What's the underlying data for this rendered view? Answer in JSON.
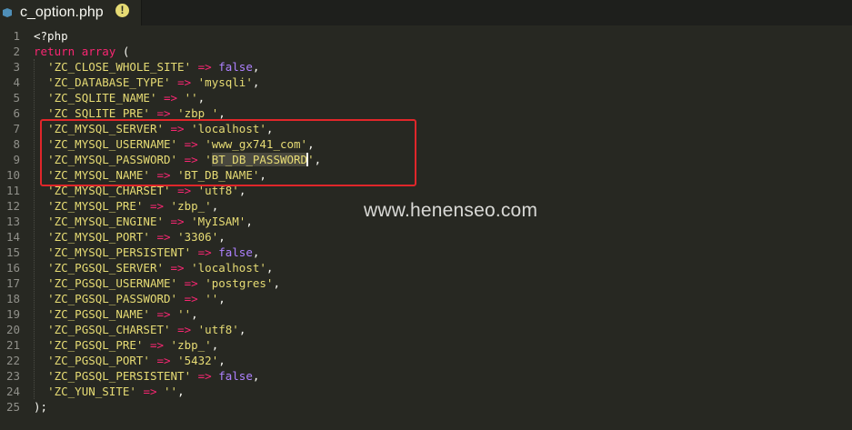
{
  "tab": {
    "filename": "c_option.php",
    "warning_glyph": "!"
  },
  "watermark": "www.henenseo.com",
  "colors": {
    "background": "#272822",
    "string": "#e6db74",
    "operator": "#f92672",
    "constant": "#ae81ff",
    "highlight_box": "#e0262a"
  },
  "lines": [
    {
      "n": "1",
      "segs": [
        [
          "p",
          "<?php"
        ]
      ]
    },
    {
      "n": "2",
      "segs": [
        [
          "k",
          "return"
        ],
        [
          "p",
          " "
        ],
        [
          "k",
          "array"
        ],
        [
          "p",
          " ("
        ]
      ]
    },
    {
      "n": "3",
      "segs": [
        [
          "i",
          "  "
        ],
        [
          "s",
          "'ZC_CLOSE_WHOLE_SITE'"
        ],
        [
          "p",
          " "
        ],
        [
          "o",
          "=>"
        ],
        [
          "p",
          " "
        ],
        [
          "c",
          "false"
        ],
        [
          "p",
          ","
        ]
      ]
    },
    {
      "n": "4",
      "segs": [
        [
          "i",
          "  "
        ],
        [
          "s",
          "'ZC_DATABASE_TYPE'"
        ],
        [
          "p",
          " "
        ],
        [
          "o",
          "=>"
        ],
        [
          "p",
          " "
        ],
        [
          "s",
          "'mysqli'"
        ],
        [
          "p",
          ","
        ]
      ]
    },
    {
      "n": "5",
      "segs": [
        [
          "i",
          "  "
        ],
        [
          "s",
          "'ZC_SQLITE_NAME'"
        ],
        [
          "p",
          " "
        ],
        [
          "o",
          "=>"
        ],
        [
          "p",
          " "
        ],
        [
          "s",
          "''"
        ],
        [
          "p",
          ","
        ]
      ]
    },
    {
      "n": "6",
      "segs": [
        [
          "i",
          "  "
        ],
        [
          "s",
          "'ZC_SQLITE_PRE'"
        ],
        [
          "p",
          " "
        ],
        [
          "o",
          "=>"
        ],
        [
          "p",
          " "
        ],
        [
          "s",
          "'zbp_'"
        ],
        [
          "p",
          ","
        ]
      ]
    },
    {
      "n": "7",
      "segs": [
        [
          "i",
          "  "
        ],
        [
          "s",
          "'ZC_MYSQL_SERVER'"
        ],
        [
          "p",
          " "
        ],
        [
          "o",
          "=>"
        ],
        [
          "p",
          " "
        ],
        [
          "s",
          "'localhost'"
        ],
        [
          "p",
          ","
        ]
      ]
    },
    {
      "n": "8",
      "segs": [
        [
          "i",
          "  "
        ],
        [
          "s",
          "'ZC_MYSQL_USERNAME'"
        ],
        [
          "p",
          " "
        ],
        [
          "o",
          "=>"
        ],
        [
          "p",
          " "
        ],
        [
          "s",
          "'www_gx741_com'"
        ],
        [
          "p",
          ","
        ]
      ]
    },
    {
      "n": "9",
      "segs": [
        [
          "i",
          "  "
        ],
        [
          "s",
          "'ZC_MYSQL_PASSWORD'"
        ],
        [
          "p",
          " "
        ],
        [
          "o",
          "=>"
        ],
        [
          "p",
          " "
        ],
        [
          "s",
          "'"
        ],
        [
          "h",
          "BT_DB_PASSWORD"
        ],
        [
          "cur",
          ""
        ],
        [
          "s",
          "'"
        ],
        [
          "p",
          ","
        ]
      ]
    },
    {
      "n": "10",
      "segs": [
        [
          "i",
          "  "
        ],
        [
          "s",
          "'ZC_MYSQL_NAME'"
        ],
        [
          "p",
          " "
        ],
        [
          "o",
          "=>"
        ],
        [
          "p",
          " "
        ],
        [
          "s",
          "'BT_DB_NAME'"
        ],
        [
          "p",
          ","
        ]
      ]
    },
    {
      "n": "11",
      "segs": [
        [
          "i",
          "  "
        ],
        [
          "s",
          "'ZC_MYSQL_CHARSET'"
        ],
        [
          "p",
          " "
        ],
        [
          "o",
          "=>"
        ],
        [
          "p",
          " "
        ],
        [
          "s",
          "'utf8'"
        ],
        [
          "p",
          ","
        ]
      ]
    },
    {
      "n": "12",
      "segs": [
        [
          "i",
          "  "
        ],
        [
          "s",
          "'ZC_MYSQL_PRE'"
        ],
        [
          "p",
          " "
        ],
        [
          "o",
          "=>"
        ],
        [
          "p",
          " "
        ],
        [
          "s",
          "'zbp_'"
        ],
        [
          "p",
          ","
        ]
      ]
    },
    {
      "n": "13",
      "segs": [
        [
          "i",
          "  "
        ],
        [
          "s",
          "'ZC_MYSQL_ENGINE'"
        ],
        [
          "p",
          " "
        ],
        [
          "o",
          "=>"
        ],
        [
          "p",
          " "
        ],
        [
          "s",
          "'MyISAM'"
        ],
        [
          "p",
          ","
        ]
      ]
    },
    {
      "n": "14",
      "segs": [
        [
          "i",
          "  "
        ],
        [
          "s",
          "'ZC_MYSQL_PORT'"
        ],
        [
          "p",
          " "
        ],
        [
          "o",
          "=>"
        ],
        [
          "p",
          " "
        ],
        [
          "s",
          "'3306'"
        ],
        [
          "p",
          ","
        ]
      ]
    },
    {
      "n": "15",
      "segs": [
        [
          "i",
          "  "
        ],
        [
          "s",
          "'ZC_MYSQL_PERSISTENT'"
        ],
        [
          "p",
          " "
        ],
        [
          "o",
          "=>"
        ],
        [
          "p",
          " "
        ],
        [
          "c",
          "false"
        ],
        [
          "p",
          ","
        ]
      ]
    },
    {
      "n": "16",
      "segs": [
        [
          "i",
          "  "
        ],
        [
          "s",
          "'ZC_PGSQL_SERVER'"
        ],
        [
          "p",
          " "
        ],
        [
          "o",
          "=>"
        ],
        [
          "p",
          " "
        ],
        [
          "s",
          "'localhost'"
        ],
        [
          "p",
          ","
        ]
      ]
    },
    {
      "n": "17",
      "segs": [
        [
          "i",
          "  "
        ],
        [
          "s",
          "'ZC_PGSQL_USERNAME'"
        ],
        [
          "p",
          " "
        ],
        [
          "o",
          "=>"
        ],
        [
          "p",
          " "
        ],
        [
          "s",
          "'postgres'"
        ],
        [
          "p",
          ","
        ]
      ]
    },
    {
      "n": "18",
      "segs": [
        [
          "i",
          "  "
        ],
        [
          "s",
          "'ZC_PGSQL_PASSWORD'"
        ],
        [
          "p",
          " "
        ],
        [
          "o",
          "=>"
        ],
        [
          "p",
          " "
        ],
        [
          "s",
          "''"
        ],
        [
          "p",
          ","
        ]
      ]
    },
    {
      "n": "19",
      "segs": [
        [
          "i",
          "  "
        ],
        [
          "s",
          "'ZC_PGSQL_NAME'"
        ],
        [
          "p",
          " "
        ],
        [
          "o",
          "=>"
        ],
        [
          "p",
          " "
        ],
        [
          "s",
          "''"
        ],
        [
          "p",
          ","
        ]
      ]
    },
    {
      "n": "20",
      "segs": [
        [
          "i",
          "  "
        ],
        [
          "s",
          "'ZC_PGSQL_CHARSET'"
        ],
        [
          "p",
          " "
        ],
        [
          "o",
          "=>"
        ],
        [
          "p",
          " "
        ],
        [
          "s",
          "'utf8'"
        ],
        [
          "p",
          ","
        ]
      ]
    },
    {
      "n": "21",
      "segs": [
        [
          "i",
          "  "
        ],
        [
          "s",
          "'ZC_PGSQL_PRE'"
        ],
        [
          "p",
          " "
        ],
        [
          "o",
          "=>"
        ],
        [
          "p",
          " "
        ],
        [
          "s",
          "'zbp_'"
        ],
        [
          "p",
          ","
        ]
      ]
    },
    {
      "n": "22",
      "segs": [
        [
          "i",
          "  "
        ],
        [
          "s",
          "'ZC_PGSQL_PORT'"
        ],
        [
          "p",
          " "
        ],
        [
          "o",
          "=>"
        ],
        [
          "p",
          " "
        ],
        [
          "s",
          "'5432'"
        ],
        [
          "p",
          ","
        ]
      ]
    },
    {
      "n": "23",
      "segs": [
        [
          "i",
          "  "
        ],
        [
          "s",
          "'ZC_PGSQL_PERSISTENT'"
        ],
        [
          "p",
          " "
        ],
        [
          "o",
          "=>"
        ],
        [
          "p",
          " "
        ],
        [
          "c",
          "false"
        ],
        [
          "p",
          ","
        ]
      ]
    },
    {
      "n": "24",
      "segs": [
        [
          "i",
          "  "
        ],
        [
          "s",
          "'ZC_YUN_SITE'"
        ],
        [
          "p",
          " "
        ],
        [
          "o",
          "=>"
        ],
        [
          "p",
          " "
        ],
        [
          "s",
          "''"
        ],
        [
          "p",
          ","
        ]
      ]
    },
    {
      "n": "25",
      "segs": [
        [
          "p",
          ");"
        ]
      ]
    }
  ]
}
